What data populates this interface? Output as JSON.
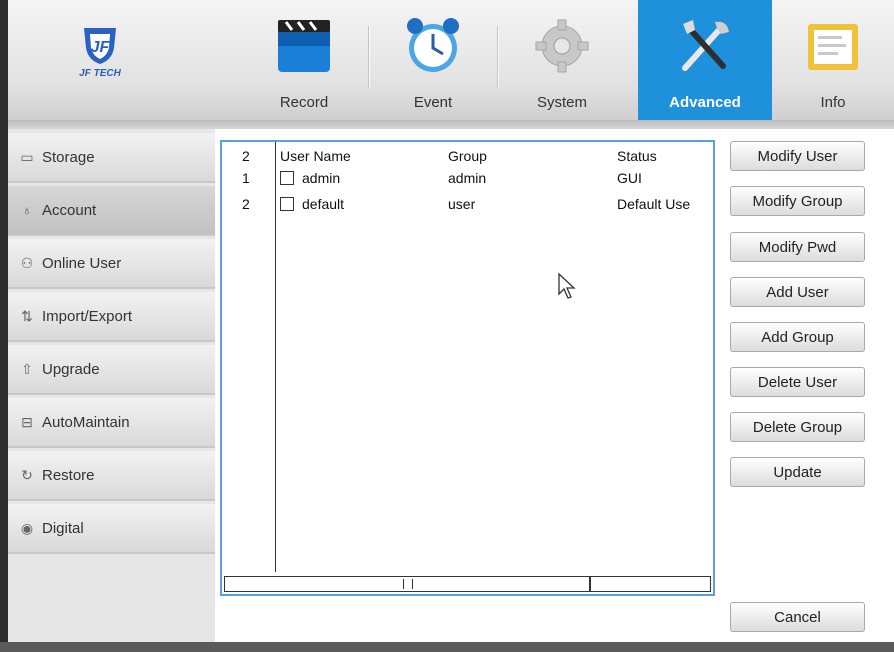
{
  "logo": {
    "text": "JF TECH"
  },
  "tabs": [
    {
      "label": "Record",
      "icon": "clapperboard-icon"
    },
    {
      "label": "Event",
      "icon": "alarm-clock-icon"
    },
    {
      "label": "System",
      "icon": "gear-icon"
    },
    {
      "label": "Advanced",
      "icon": "tools-icon",
      "active": true
    },
    {
      "label": "Info",
      "icon": "info-panel-icon"
    }
  ],
  "sidebar": {
    "items": [
      {
        "label": "Storage",
        "icon": "storage-icon"
      },
      {
        "label": "Account",
        "icon": "account-icon",
        "active": true
      },
      {
        "label": "Online User",
        "icon": "online-user-icon"
      },
      {
        "label": "Import/Export",
        "icon": "import-export-icon"
      },
      {
        "label": "Upgrade",
        "icon": "upgrade-icon"
      },
      {
        "label": "AutoMaintain",
        "icon": "auto-maintain-icon"
      },
      {
        "label": "Restore",
        "icon": "restore-icon"
      },
      {
        "label": "Digital",
        "icon": "digital-icon"
      }
    ]
  },
  "user_list": {
    "count": "2",
    "columns": {
      "user_name": "User Name",
      "group": "Group",
      "status": "Status"
    },
    "rows": [
      {
        "index": "1",
        "user_name": "admin",
        "group": "admin",
        "status": "GUI",
        "checked": false
      },
      {
        "index": "2",
        "user_name": "default",
        "group": "user",
        "status": "Default Use",
        "checked": false
      }
    ]
  },
  "buttons": {
    "modify_user": "Modify User",
    "modify_group": "Modify Group",
    "modify_pwd": "Modify Pwd",
    "add_user": "Add User",
    "add_group": "Add Group",
    "delete_user": "Delete User",
    "delete_group": "Delete Group",
    "update": "Update",
    "cancel": "Cancel"
  },
  "colors": {
    "active_tab": "#1e90dc",
    "list_border": "#5aa0dc"
  }
}
